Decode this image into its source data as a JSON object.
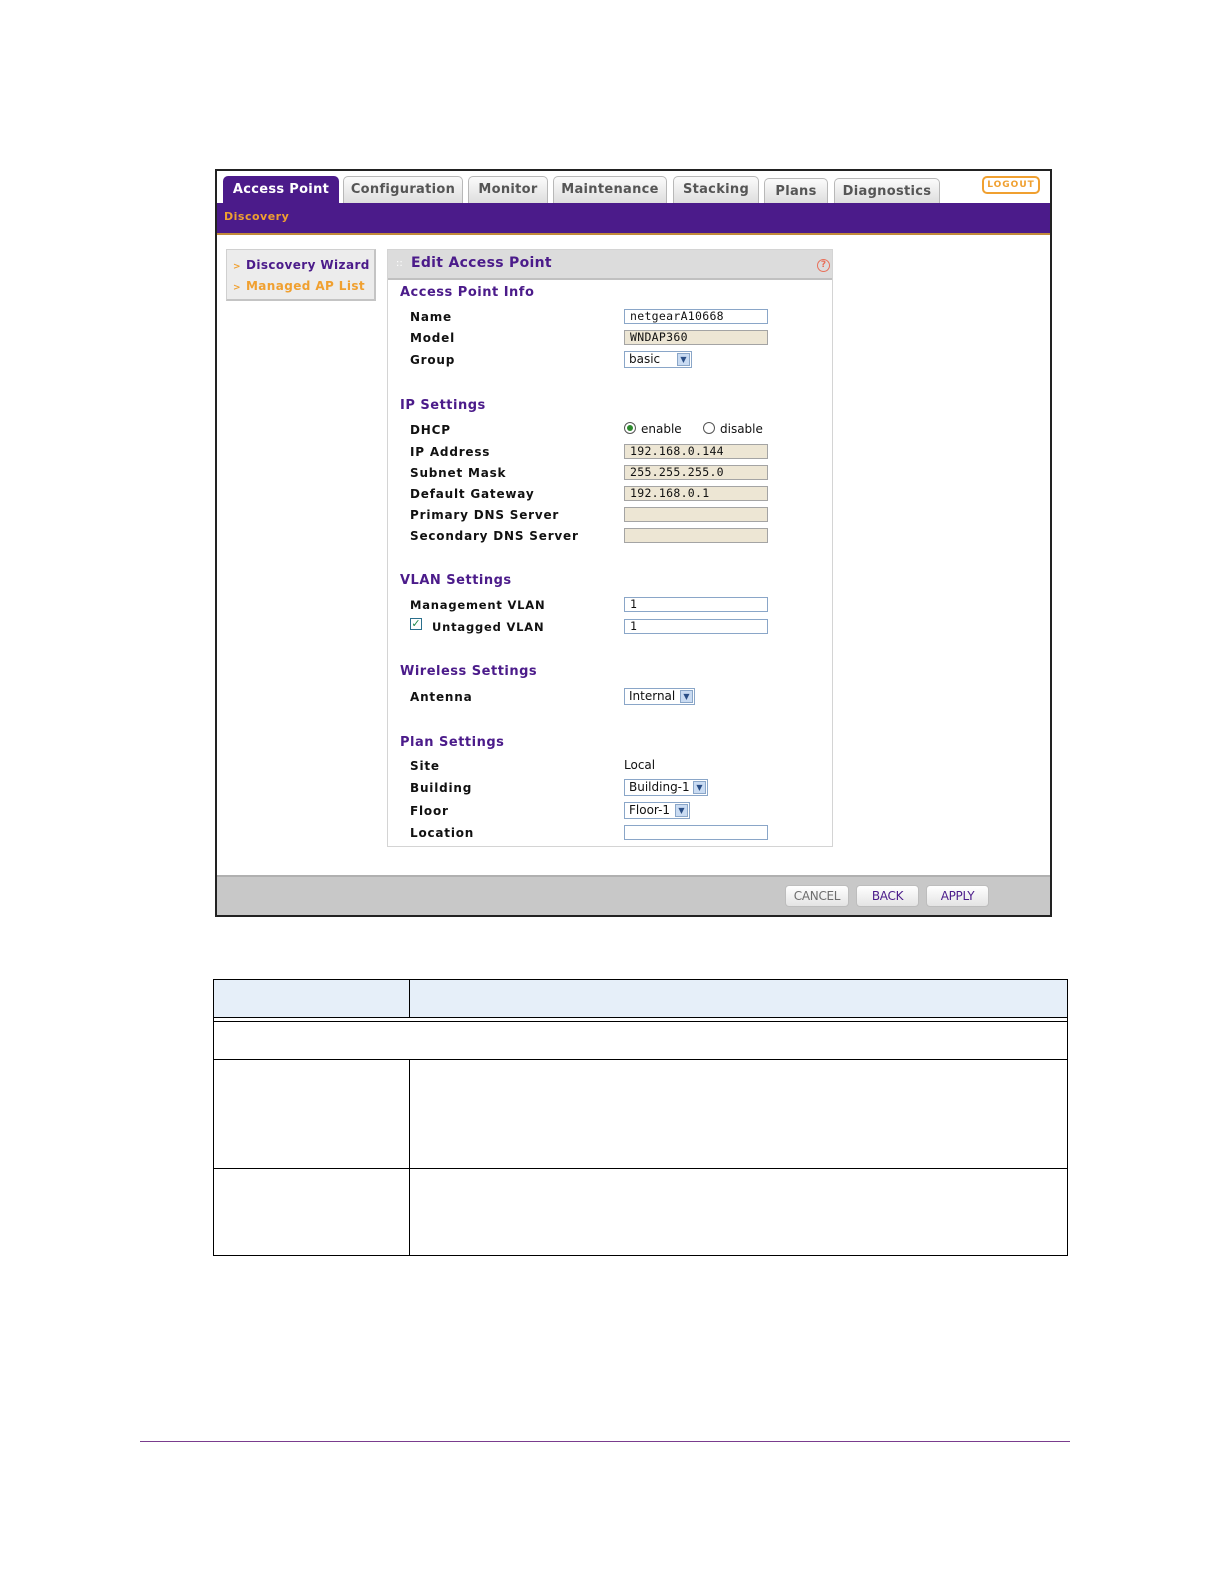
{
  "tabs": [
    {
      "label": "Access Point",
      "active": true
    },
    {
      "label": "Configuration",
      "active": false
    },
    {
      "label": "Monitor",
      "active": false
    },
    {
      "label": "Maintenance",
      "active": false
    },
    {
      "label": "Stacking",
      "active": false
    },
    {
      "label": "Plans",
      "active": false
    },
    {
      "label": "Diagnostics",
      "active": false
    }
  ],
  "logout_label": "LOGOUT",
  "subnav": {
    "current": "Discovery"
  },
  "sidebar": {
    "items": [
      {
        "label": "Discovery Wizard"
      },
      {
        "label": "Managed AP List"
      }
    ]
  },
  "panel": {
    "title": "Edit Access Point",
    "help_icon": "?",
    "sections": {
      "ap_info": "Access Point Info",
      "ip": "IP Settings",
      "vlan": "VLAN Settings",
      "wireless": "Wireless Settings",
      "plan": "Plan Settings"
    },
    "fields": {
      "name": {
        "label": "Name",
        "value": "netgearA10668"
      },
      "model": {
        "label": "Model",
        "value": "WNDAP360"
      },
      "group": {
        "label": "Group",
        "value": "basic"
      },
      "dhcp": {
        "label": "DHCP",
        "enable": "enable",
        "disable": "disable",
        "selected": "enable"
      },
      "ip_address": {
        "label": "IP Address",
        "value": "192.168.0.144"
      },
      "subnet_mask": {
        "label": "Subnet Mask",
        "value": "255.255.255.0"
      },
      "default_gateway": {
        "label": "Default Gateway",
        "value": "192.168.0.1"
      },
      "primary_dns": {
        "label": "Primary DNS Server",
        "value": ""
      },
      "secondary_dns": {
        "label": "Secondary DNS Server",
        "value": ""
      },
      "management_vlan": {
        "label": "Management VLAN",
        "value": "1"
      },
      "untagged_vlan": {
        "label": "Untagged VLAN",
        "value": "1",
        "checked": true
      },
      "antenna": {
        "label": "Antenna",
        "value": "Internal"
      },
      "site": {
        "label": "Site",
        "value": "Local"
      },
      "building": {
        "label": "Building",
        "value": "Building-1"
      },
      "floor": {
        "label": "Floor",
        "value": "Floor-1"
      },
      "location": {
        "label": "Location",
        "value": ""
      }
    }
  },
  "buttons": {
    "cancel": "CANCEL",
    "back": "BACK",
    "apply": "APPLY"
  },
  "colors": {
    "brand_purple": "#4b1b8a",
    "accent_orange": "#f0a030"
  }
}
